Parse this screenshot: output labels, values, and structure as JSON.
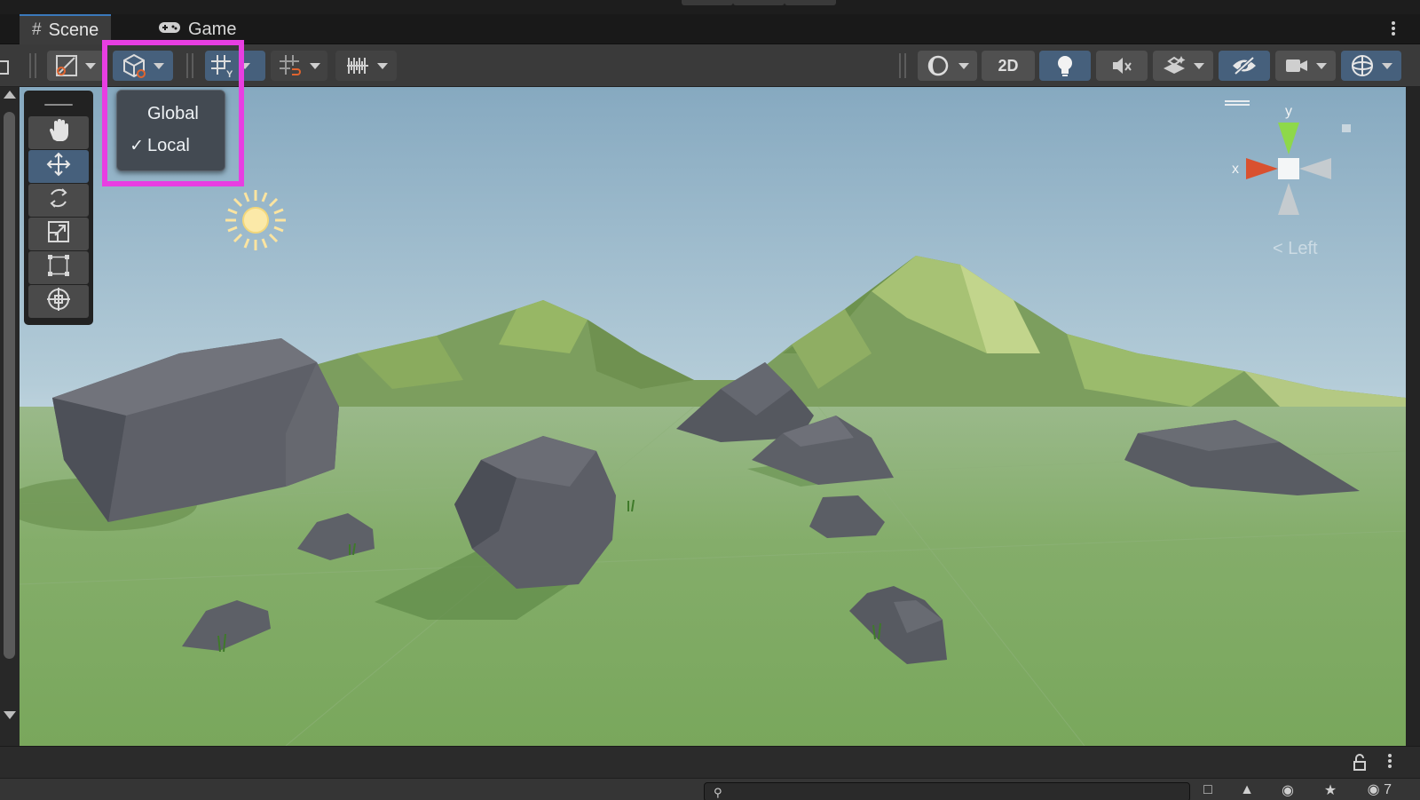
{
  "tabs": [
    {
      "label": "Scene",
      "icon": "grid-hash-icon",
      "active": true
    },
    {
      "label": "Game",
      "icon": "gamepad-icon",
      "active": false
    }
  ],
  "toolbar": {
    "draw_mode": "draw-mode-icon",
    "pivot_rotation": "local-transform-cube-icon",
    "grid_snapping": "grid-snap-icon",
    "increment_snap": "increment-snap-icon",
    "ruler": "ruler-icon",
    "shading": "shading-sphere-icon",
    "mode_2d_label": "2D",
    "lighting": "lightbulb-icon",
    "audio": "audio-mute-icon",
    "effects": "effects-icon",
    "visibility": "hidden-objects-icon",
    "camera": "camera-icon",
    "gizmos": "gizmos-icon"
  },
  "orientation_menu": {
    "items": [
      {
        "label": "Global",
        "checked": false
      },
      {
        "label": "Local",
        "checked": true
      }
    ],
    "check_glyph": "✓"
  },
  "tools": [
    {
      "name": "hand-tool",
      "active": false
    },
    {
      "name": "move-tool",
      "active": true
    },
    {
      "name": "rotate-tool",
      "active": false
    },
    {
      "name": "scale-tool",
      "active": false
    },
    {
      "name": "rect-tool",
      "active": false
    },
    {
      "name": "transform-tool",
      "active": false
    }
  ],
  "gizmo": {
    "x_label": "x",
    "y_label": "y",
    "view_label": "Left",
    "x_color": "#d9512f",
    "y_color": "#8ed84a"
  },
  "status": {
    "hidden_count": "7"
  },
  "colors": {
    "accent": "#3a79bb",
    "active_button": "#46607c",
    "highlight": "#e83ee2"
  }
}
